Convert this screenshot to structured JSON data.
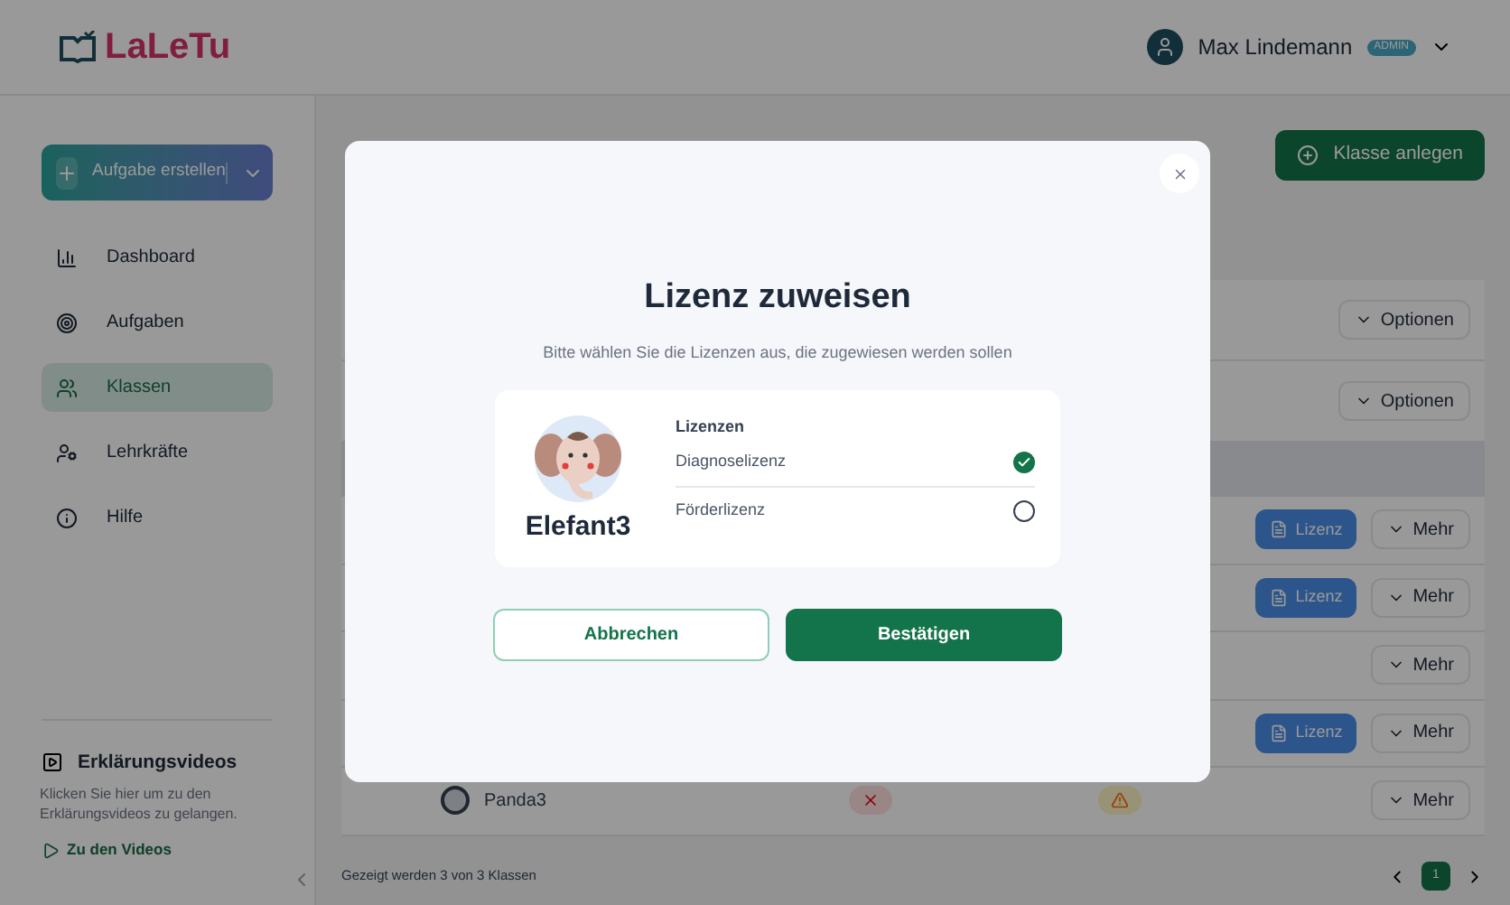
{
  "header": {
    "logo": "LaLeTu",
    "user_name": "Max Lindemann",
    "role_badge": "ADMIN"
  },
  "sidebar": {
    "create_button": "Aufgabe erstellen",
    "items": [
      {
        "label": "Dashboard",
        "selected": false
      },
      {
        "label": "Aufgaben",
        "selected": false
      },
      {
        "label": "Klassen",
        "selected": true
      },
      {
        "label": "Lehrkräfte",
        "selected": false
      },
      {
        "label": "Hilfe",
        "selected": false
      }
    ],
    "videos": {
      "title": "Erklärungsvideos",
      "text": "Klicken Sie hier um zu den Erklärungsvideos zu gelangen.",
      "link": "Zu den Videos"
    }
  },
  "main": {
    "add_button": "Klasse anlegen",
    "class_rows": [
      {
        "options_button": "Optionen"
      },
      {
        "options_button": "Optionen"
      }
    ],
    "student_rows": [
      {
        "license_button": "Lizenz",
        "more_button": "Mehr"
      },
      {
        "license_button": "Lizenz",
        "more_button": "Mehr"
      },
      {
        "more_button": "Mehr"
      },
      {
        "license_button": "Lizenz",
        "more_button": "Mehr"
      },
      {
        "name": "Panda3",
        "statuses": [
          {
            "kind": "cross"
          },
          {
            "kind": "warning"
          }
        ],
        "more_button": "Mehr"
      }
    ],
    "footer": "Gezeigt werden 3 von 3 Klassen",
    "pagination": {
      "pages": [
        {
          "label": "1",
          "selected": true
        }
      ]
    }
  },
  "modal": {
    "title": "Lizenz zuweisen",
    "subtitle": "Bitte wählen Sie die Lizenzen aus, die zugewiesen werden sollen",
    "student_name": "Elefant3",
    "licenses_heading": "Lizenzen",
    "licenses": [
      {
        "label": "Diagnoselizenz",
        "checked": true
      },
      {
        "label": "Förderlizenz",
        "checked": false
      }
    ],
    "cancel_button": "Abbrechen",
    "confirm_button": "Bestätigen"
  }
}
